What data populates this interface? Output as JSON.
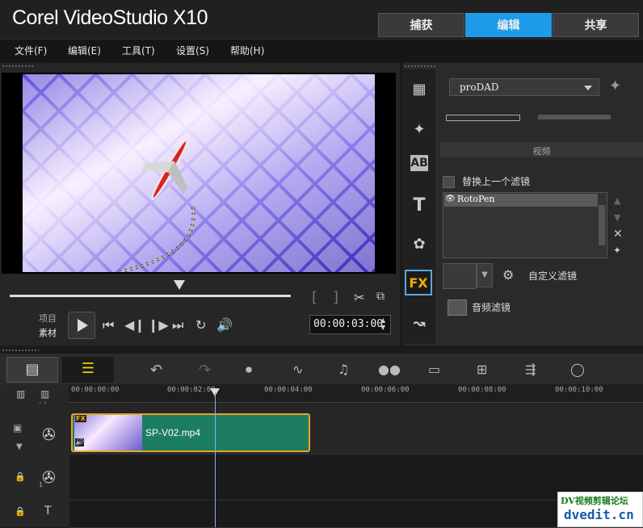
{
  "app": {
    "title": "Corel VideoStudio X10"
  },
  "top_tabs": [
    {
      "label": "捕获"
    },
    {
      "label": "编辑",
      "active": true
    },
    {
      "label": "共享"
    }
  ],
  "menu": [
    "文件(F)",
    "编辑(E)",
    "工具(T)",
    "设置(S)",
    "帮助(H)"
  ],
  "player": {
    "mode_project": "项目",
    "mode_clip": "素材",
    "timecode": "00:00:03:00",
    "bracket_left": "[",
    "bracket_right": "]"
  },
  "library": {
    "filter_category": "proDAD",
    "section_header": "视频",
    "replace_last_filter": "替换上一个滤镜",
    "applied_filters": [
      "RotoPen"
    ],
    "custom_filter_label": "自定义滤镜",
    "audio_filter_label": "音频滤镜",
    "fx_label": "FX",
    "ab_label": "AB",
    "t_label": "T"
  },
  "timeline": {
    "ruler_ticks": [
      "00:00:00:00",
      "00:00:02:00",
      "00:00:04:00",
      "00:00:06:00",
      "00:00:08:00",
      "00:00:10:00"
    ],
    "clip": {
      "name": "SP-V02.mp4",
      "badge": "FX"
    },
    "track_number": "1",
    "title_track_label": "T",
    "zoom_label": "+/−"
  },
  "watermark": {
    "line1": "DV视频剪辑论坛",
    "line2": "dvedit.cn"
  },
  "colors": {
    "accent_tab": "#1e9be8",
    "clip_fill": "#1c7d63",
    "clip_border": "#e8a42a",
    "fx_icon": "#f0b000"
  }
}
